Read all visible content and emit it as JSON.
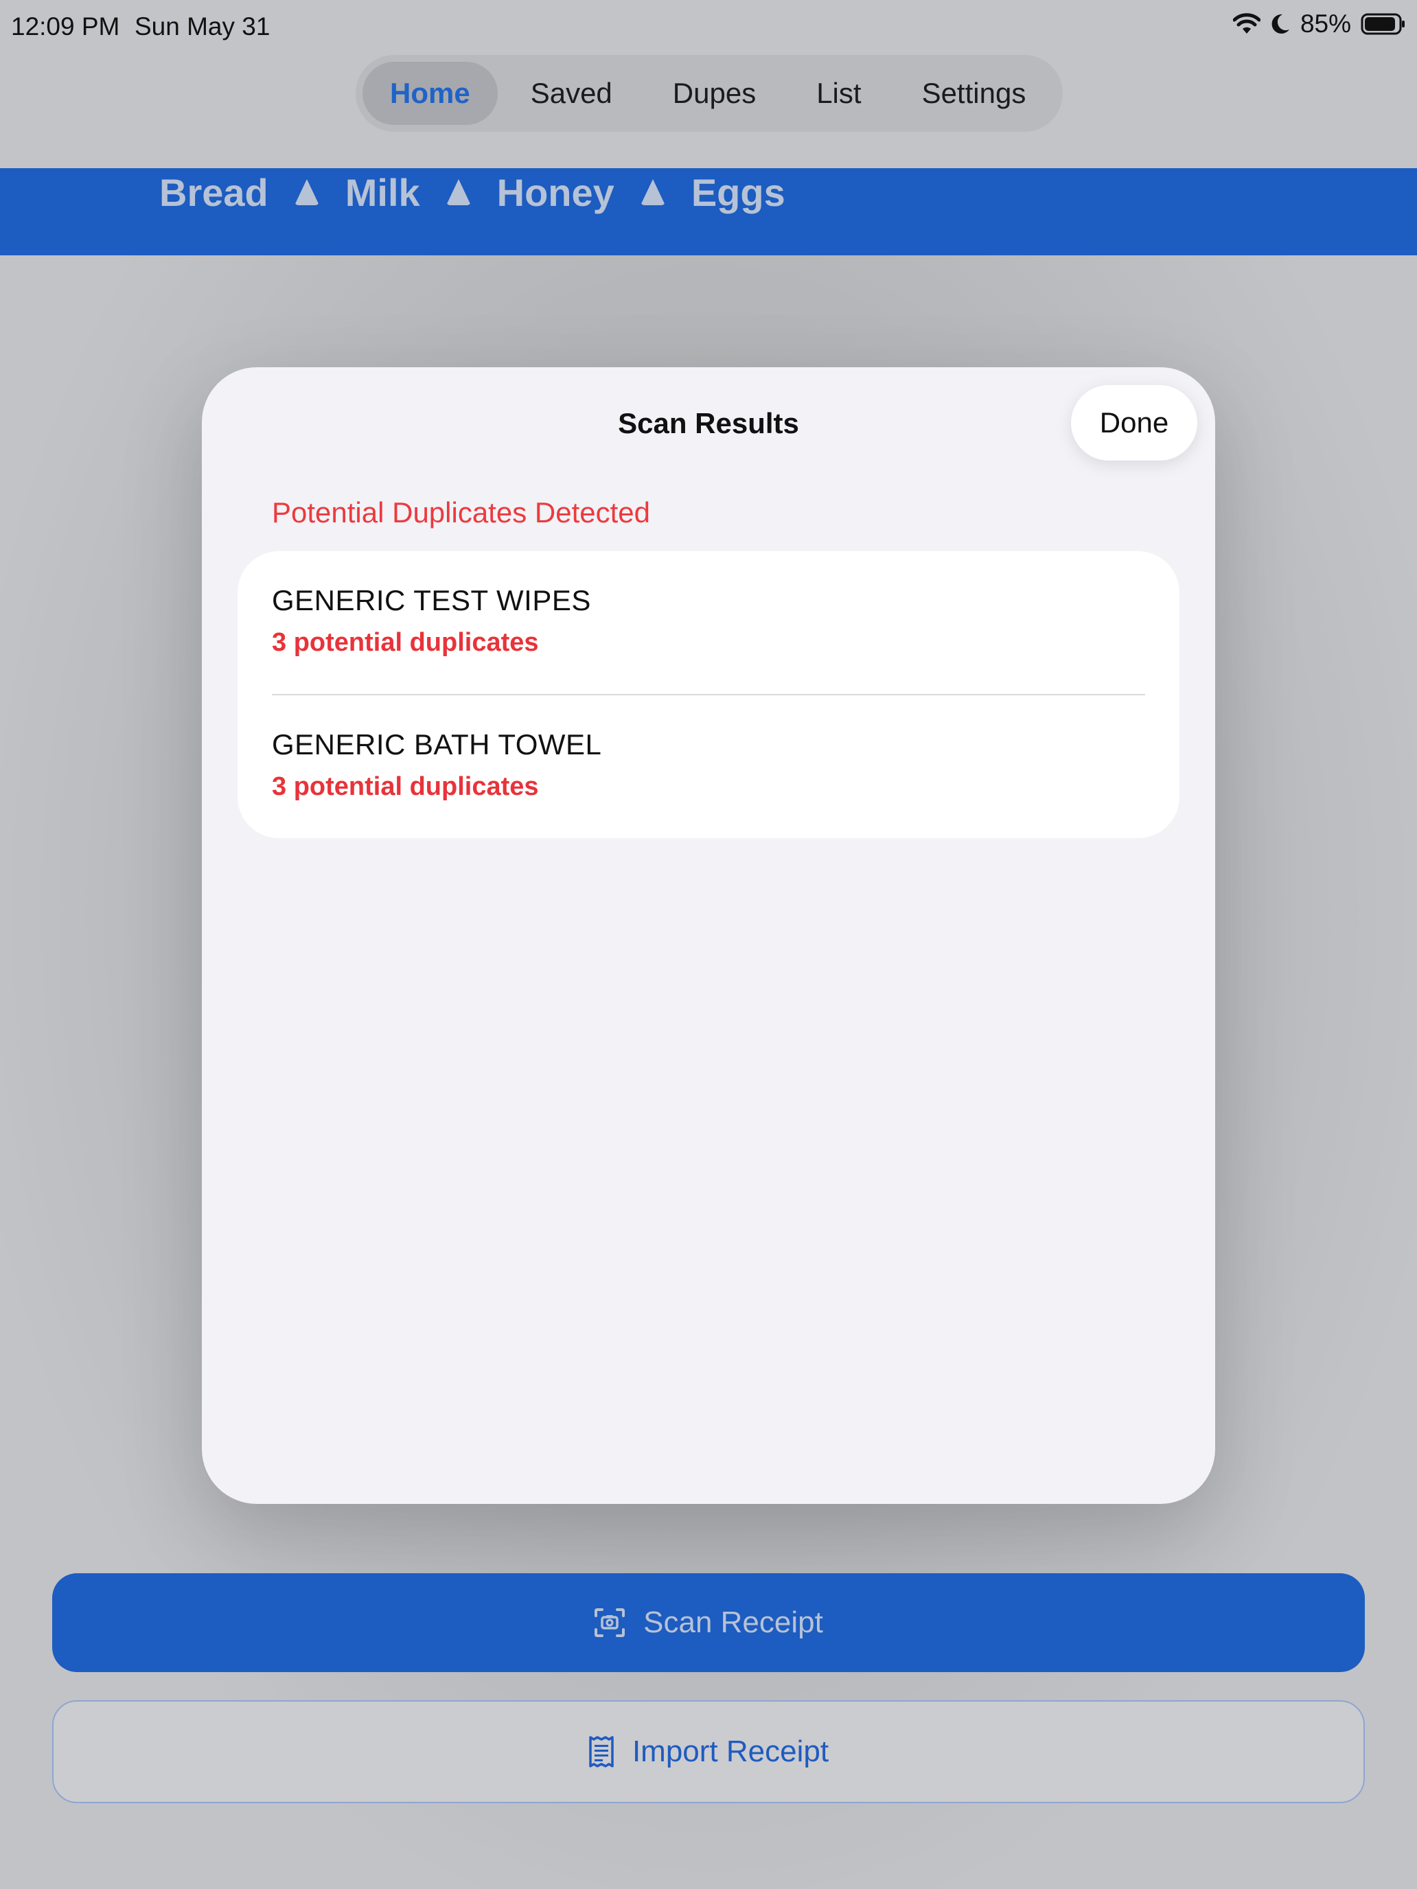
{
  "status_bar": {
    "time": "12:09 PM",
    "date": "Sun May 31",
    "battery": "85%",
    "icons": [
      "wifi-icon",
      "moon-icon",
      "battery-icon"
    ]
  },
  "tabs": [
    {
      "label": "Home",
      "active": true
    },
    {
      "label": "Saved",
      "active": false
    },
    {
      "label": "Dupes",
      "active": false
    },
    {
      "label": "List",
      "active": false
    },
    {
      "label": "Settings",
      "active": false
    }
  ],
  "banner": {
    "items": [
      "Bread",
      "Milk",
      "Honey",
      "Eggs"
    ]
  },
  "modal": {
    "title": "Scan Results",
    "done_label": "Done",
    "section_header": "Potential Duplicates Detected",
    "results": [
      {
        "name": "GENERIC TEST WIPES",
        "detail": "3 potential duplicates"
      },
      {
        "name": "GENERIC BATH TOWEL",
        "detail": "3 potential duplicates"
      }
    ]
  },
  "actions": {
    "scan_label": "Scan Receipt",
    "import_label": "Import Receipt"
  },
  "colors": {
    "accent_blue": "#1d5cc0",
    "alert_red": "#e8333a",
    "modal_bg": "#f2f2f7"
  }
}
